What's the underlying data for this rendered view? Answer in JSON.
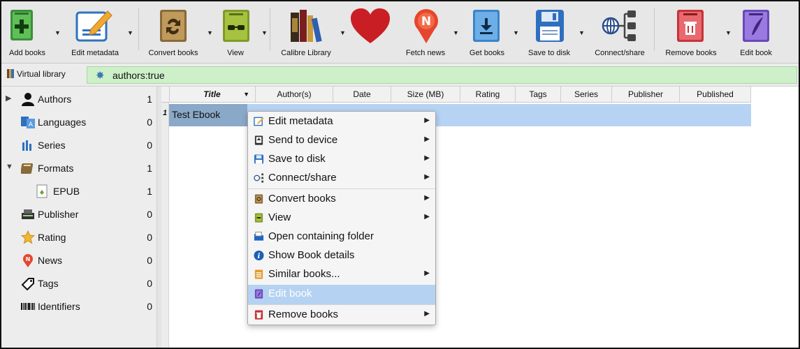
{
  "toolbar": {
    "buttons": [
      {
        "label": "Add books",
        "icon": "add-books-icon"
      },
      {
        "label": "Edit metadata",
        "icon": "edit-metadata-icon"
      },
      {
        "label": "Convert books",
        "icon": "convert-books-icon"
      },
      {
        "label": "View",
        "icon": "view-icon"
      },
      {
        "label": "Calibre Library",
        "icon": "library-icon"
      },
      {
        "label": "",
        "icon": "donate-heart-icon"
      },
      {
        "label": "Fetch news",
        "icon": "fetch-news-icon"
      },
      {
        "label": "Get books",
        "icon": "get-books-icon"
      },
      {
        "label": "Save to disk",
        "icon": "save-to-disk-icon"
      },
      {
        "label": "Connect/share",
        "icon": "connect-share-icon"
      },
      {
        "label": "Remove books",
        "icon": "remove-books-icon"
      },
      {
        "label": "Edit book",
        "icon": "edit-book-icon"
      }
    ]
  },
  "search": {
    "virtual_library_label": "Virtual library",
    "query": "authors:true"
  },
  "sidebar": {
    "items": [
      {
        "label": "Authors",
        "count": "1",
        "expandable": true,
        "expanded": false,
        "icon": "person-icon"
      },
      {
        "label": "Languages",
        "count": "0",
        "expandable": false,
        "icon": "languages-icon"
      },
      {
        "label": "Series",
        "count": "0",
        "expandable": false,
        "icon": "series-icon"
      },
      {
        "label": "Formats",
        "count": "1",
        "expandable": true,
        "expanded": true,
        "icon": "formats-icon"
      },
      {
        "label": "EPUB",
        "count": "1",
        "expandable": false,
        "child": true,
        "icon": "epub-icon"
      },
      {
        "label": "Publisher",
        "count": "0",
        "expandable": false,
        "icon": "publisher-icon"
      },
      {
        "label": "Rating",
        "count": "0",
        "expandable": false,
        "icon": "star-icon"
      },
      {
        "label": "News",
        "count": "0",
        "expandable": false,
        "icon": "news-icon"
      },
      {
        "label": "Tags",
        "count": "0",
        "expandable": false,
        "icon": "tag-icon"
      },
      {
        "label": "Identifiers",
        "count": "0",
        "expandable": false,
        "icon": "barcode-icon"
      }
    ]
  },
  "table": {
    "columns": [
      "Title",
      "Author(s)",
      "Date",
      "Size (MB)",
      "Rating",
      "Tags",
      "Series",
      "Publisher",
      "Published"
    ],
    "rows": [
      {
        "num": "1",
        "title": "Test Ebook"
      }
    ]
  },
  "context_menu": {
    "items": [
      {
        "label": "Edit metadata",
        "submenu": true,
        "icon": "edit-metadata-icon"
      },
      {
        "label": "Send to device",
        "submenu": true,
        "icon": "send-to-device-icon"
      },
      {
        "label": "Save to disk",
        "submenu": true,
        "icon": "save-to-disk-icon"
      },
      {
        "label": "Connect/share",
        "submenu": true,
        "icon": "connect-share-icon"
      },
      {
        "label": "Convert books",
        "submenu": true,
        "icon": "convert-books-icon"
      },
      {
        "label": "View",
        "submenu": true,
        "icon": "view-icon"
      },
      {
        "label": "Open containing folder",
        "submenu": false,
        "icon": "folder-icon"
      },
      {
        "label": "Show Book details",
        "submenu": false,
        "icon": "info-icon"
      },
      {
        "label": "Similar books...",
        "submenu": true,
        "icon": "similar-books-icon"
      },
      {
        "label": "Edit book",
        "submenu": false,
        "highlighted": true,
        "icon": "edit-book-icon"
      },
      {
        "label": "Remove books",
        "submenu": true,
        "icon": "remove-books-icon"
      }
    ]
  },
  "colors": {
    "search_bg": "#cdf0c9",
    "selection": "#b6d3f3",
    "menu_highlight": "#b5d2f2"
  }
}
